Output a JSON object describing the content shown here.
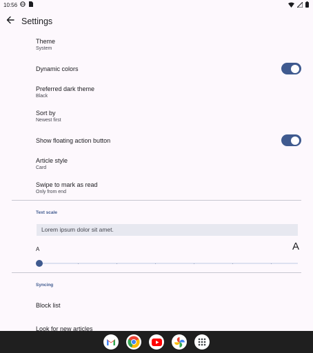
{
  "status_bar": {
    "time": "10:56"
  },
  "top_bar": {
    "title": "Settings"
  },
  "preferences": {
    "theme": {
      "title": "Theme",
      "summary": "System"
    },
    "dynamic_colors": {
      "title": "Dynamic colors",
      "enabled": true
    },
    "dark_theme": {
      "title": "Preferred dark theme",
      "summary": "Black"
    },
    "sort_by": {
      "title": "Sort by",
      "summary": "Newest first"
    },
    "fab": {
      "title": "Show floating action button",
      "enabled": true
    },
    "article_style": {
      "title": "Article style",
      "summary": "Card"
    },
    "swipe": {
      "title": "Swipe to mark as read",
      "summary": "Only from end"
    }
  },
  "text_scale": {
    "header": "Text scale",
    "sample": "Lorem ipsum dolor sit amet.",
    "small_label": "A",
    "large_label": "A",
    "slider_value": 0
  },
  "syncing": {
    "header": "Syncing",
    "block_list": "Block list",
    "look_for_new": "Look for new articles"
  },
  "dock": {
    "apps": [
      "gmail-icon",
      "chrome-icon",
      "youtube-icon",
      "photos-icon",
      "app-drawer-icon"
    ]
  },
  "colors": {
    "accent": "#3f5a8f",
    "background": "#fdf8fd",
    "nav_bar": "#1f1f1f"
  }
}
